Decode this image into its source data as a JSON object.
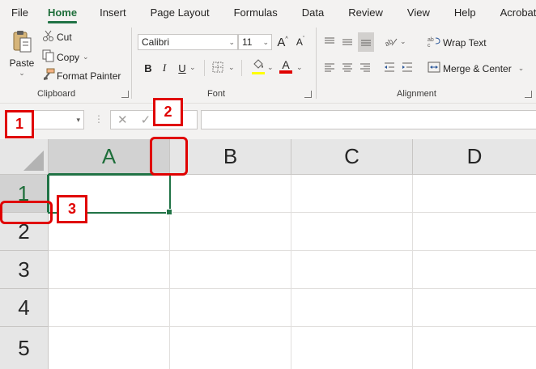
{
  "menu": {
    "tabs": [
      "File",
      "Home",
      "Insert",
      "Page Layout",
      "Formulas",
      "Data",
      "Review",
      "View",
      "Help",
      "Acrobat"
    ],
    "active": "Home"
  },
  "clipboard": {
    "paste_label": "Paste",
    "cut_label": "Cut",
    "copy_label": "Copy",
    "format_painter_label": "Format Painter",
    "group_label": "Clipboard"
  },
  "font": {
    "font_name": "Calibri",
    "font_size": "11",
    "bold": "B",
    "italic": "I",
    "underline": "U",
    "grow": "A",
    "shrink": "A",
    "font_color_letter": "A",
    "group_label": "Font"
  },
  "alignment": {
    "wrap_text_label": "Wrap Text",
    "merge_center_label": "Merge & Center",
    "group_label": "Alignment"
  },
  "grid": {
    "columns": [
      "A",
      "B",
      "C",
      "D"
    ],
    "rows": [
      "1",
      "2",
      "3",
      "4",
      "5"
    ],
    "selected_column": "A",
    "selected_row": "1"
  },
  "callouts": {
    "one": "1",
    "two": "2",
    "three": "3"
  },
  "colors": {
    "accent": "#217346",
    "callout": "#e00000"
  }
}
